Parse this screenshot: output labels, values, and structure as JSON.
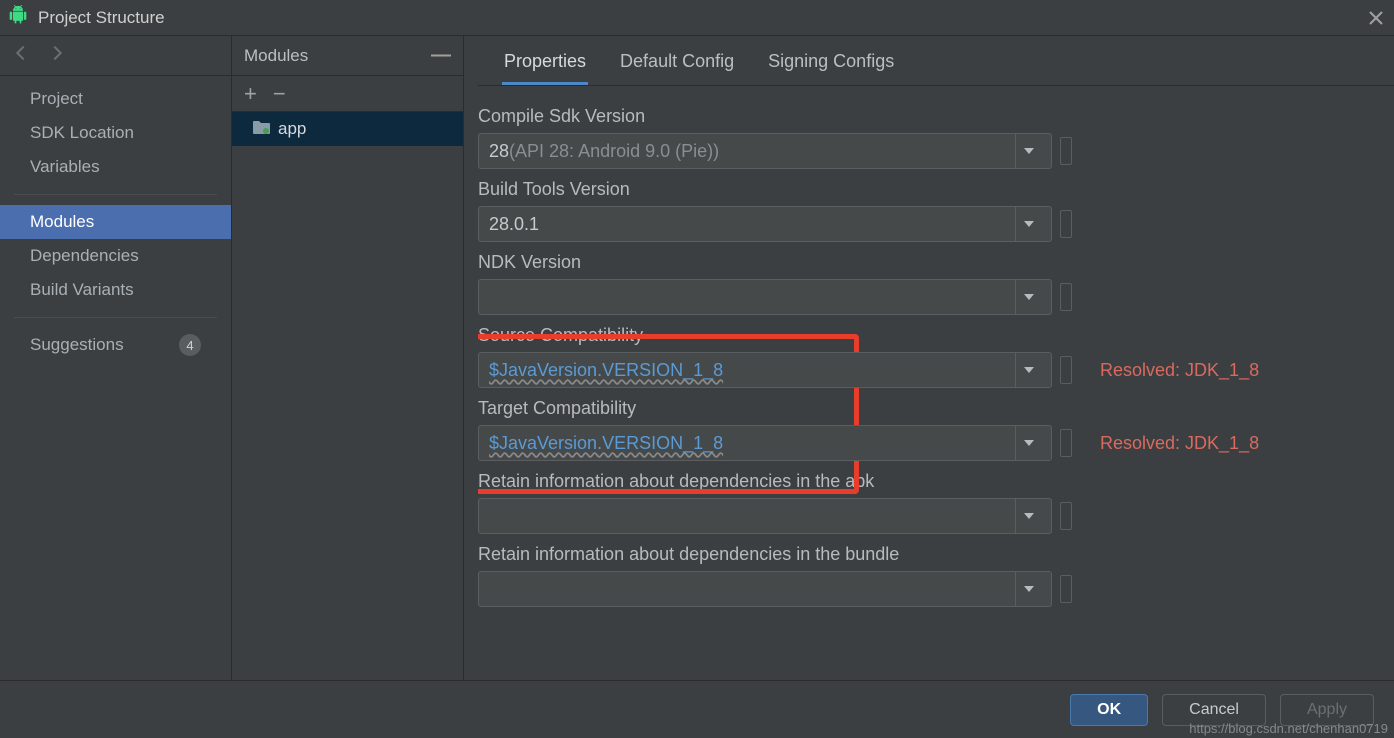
{
  "title": "Project Structure",
  "nav": {
    "items": [
      "Project",
      "SDK Location",
      "Variables",
      "Modules",
      "Dependencies",
      "Build Variants",
      "Suggestions"
    ],
    "selected": "Modules",
    "suggestions_badge": "4"
  },
  "modules": {
    "header": "Modules",
    "items": [
      {
        "name": "app"
      }
    ]
  },
  "tabs": {
    "items": [
      "Properties",
      "Default Config",
      "Signing Configs"
    ],
    "active": "Properties"
  },
  "fields": {
    "compile_sdk": {
      "label": "Compile Sdk Version",
      "value": "28",
      "hint": " (API 28: Android 9.0 (Pie))"
    },
    "build_tools": {
      "label": "Build Tools Version",
      "value": "28.0.1"
    },
    "ndk": {
      "label": "NDK Version",
      "value": ""
    },
    "source_compat": {
      "label": "Source Compatibility",
      "value": "$JavaVersion.VERSION_1_8",
      "resolved": "Resolved: JDK_1_8"
    },
    "target_compat": {
      "label": "Target Compatibility",
      "value": "$JavaVersion.VERSION_1_8",
      "resolved": "Resolved: JDK_1_8"
    },
    "retain_apk": {
      "label": "Retain information about dependencies in the apk",
      "value": ""
    },
    "retain_bundle": {
      "label": "Retain information about dependencies in the bundle",
      "value": ""
    }
  },
  "buttons": {
    "ok": "OK",
    "cancel": "Cancel",
    "apply": "Apply"
  },
  "watermark": "https://blog.csdn.net/chenhan0719"
}
